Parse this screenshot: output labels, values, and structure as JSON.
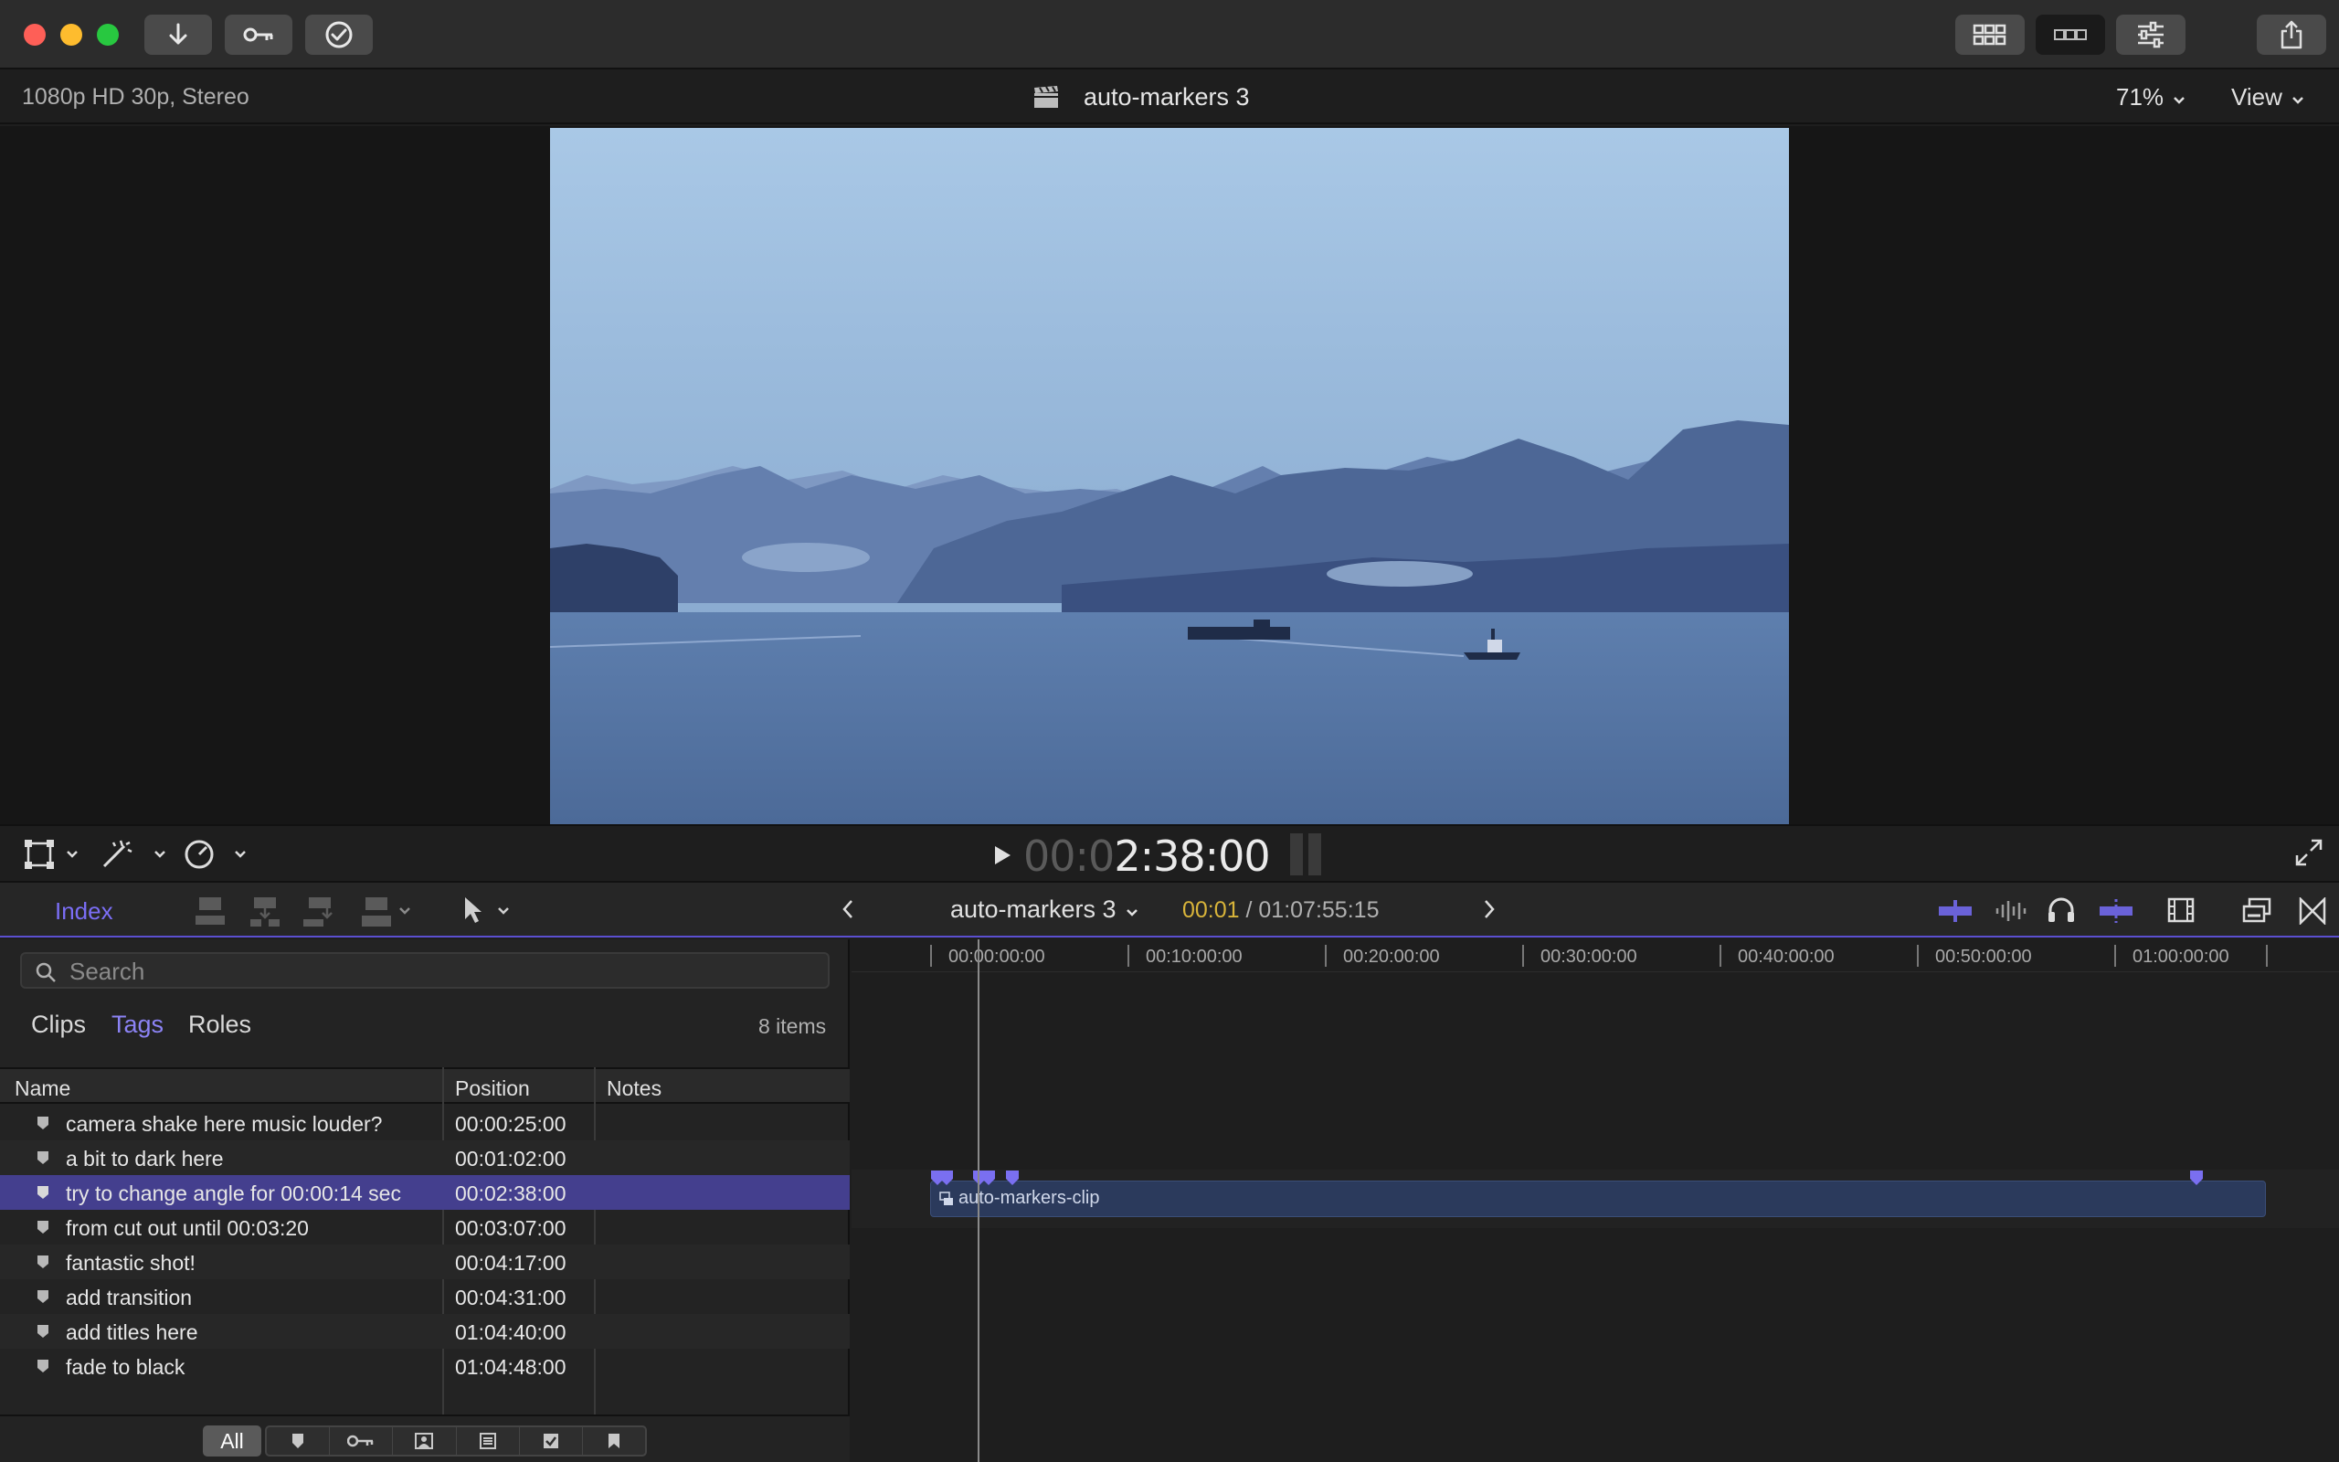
{
  "window": {
    "toolbar_buttons": [
      "import-icon",
      "keyword-icon",
      "background-tasks-icon"
    ],
    "right_buttons": [
      "browser-icon",
      "timeline-icon",
      "inspector-icon",
      "share-icon"
    ]
  },
  "viewer": {
    "format": "1080p HD 30p, Stereo",
    "project_title": "auto-markers 3",
    "zoom": "71%",
    "view_menu": "View",
    "timecode_dim": "00:0",
    "timecode_main": "2:38:00"
  },
  "timeline_toolbar": {
    "index_label": "Index",
    "project_name": "auto-markers 3",
    "duration_current": "00:01",
    "duration_total": " / 01:07:55:15"
  },
  "index": {
    "search_placeholder": "Search",
    "tabs": [
      "Clips",
      "Tags",
      "Roles"
    ],
    "active_tab": "Tags",
    "items_count": "8 items",
    "columns": [
      "Name",
      "Position",
      "Notes"
    ],
    "rows": [
      {
        "name": "camera shake here music louder?",
        "position": "00:00:25:00",
        "notes": ""
      },
      {
        "name": "a bit to dark here",
        "position": "00:01:02:00",
        "notes": ""
      },
      {
        "name": "try to change angle for 00:00:14 sec",
        "position": "00:02:38:00",
        "notes": ""
      },
      {
        "name": "from cut out until 00:03:20",
        "position": "00:03:07:00",
        "notes": ""
      },
      {
        "name": "fantastic shot!",
        "position": "00:04:17:00",
        "notes": ""
      },
      {
        "name": "add transition",
        "position": "00:04:31:00",
        "notes": ""
      },
      {
        "name": "add titles here",
        "position": "01:04:40:00",
        "notes": ""
      },
      {
        "name": "fade to black",
        "position": "01:04:48:00",
        "notes": ""
      }
    ],
    "selected_row": 2,
    "filter_all": "All"
  },
  "timeline": {
    "ruler": [
      "00:00:00:00",
      "00:10:00:00",
      "00:20:00:00",
      "00:30:00:00",
      "00:40:00:00",
      "00:50:00:00",
      "01:00:00:00"
    ],
    "clip_name": "auto-markers-clip"
  },
  "colors": {
    "accent": "#7b6ef6",
    "selection": "#443f8e",
    "clip": "#2b3a5c",
    "marker": "#7a6ff0",
    "timecode_yellow": "#d8b43a"
  }
}
